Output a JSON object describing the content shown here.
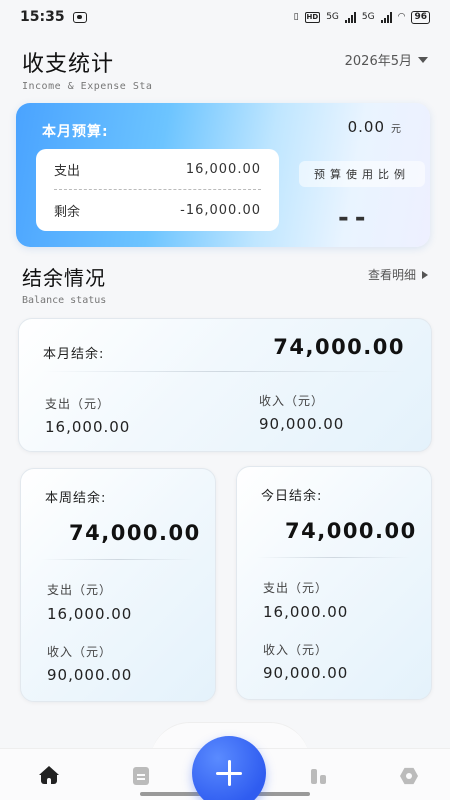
{
  "status_bar": {
    "time": "15:35",
    "battery": "96",
    "network_labels": [
      "HD",
      "5G",
      "5G"
    ]
  },
  "header": {
    "title": "收支统计",
    "subtitle": "Income & Expense Sta",
    "month": "2026年5月"
  },
  "budget": {
    "label": "本月预算:",
    "amount": "0.00",
    "unit": "元",
    "expense_label": "支出",
    "expense_value": "16,000.00",
    "remaining_label": "剩余",
    "remaining_value": "-16,000.00",
    "ratio_label": "预算使用比例",
    "ratio_value": "--"
  },
  "balance_section": {
    "title": "结余情况",
    "subtitle": "Balance status",
    "view_detail": "查看明细"
  },
  "month_card": {
    "label": "本月结余:",
    "balance": "74,000.00",
    "expense_label": "支出（元）",
    "expense": "16,000.00",
    "income_label": "收入（元）",
    "income": "90,000.00"
  },
  "week_card": {
    "label": "本周结余:",
    "balance": "74,000.00",
    "expense_label": "支出（元）",
    "expense": "16,000.00",
    "income_label": "收入（元）",
    "income": "90,000.00"
  },
  "day_card": {
    "label": "今日结余:",
    "balance": "74,000.00",
    "expense_label": "支出（元）",
    "expense": "16,000.00",
    "income_label": "收入（元）",
    "income": "90,000.00"
  },
  "tab_bar": {
    "items": [
      "home-icon",
      "document-icon",
      "chart-icon",
      "settings-icon"
    ],
    "accent": "#2f5cf0"
  }
}
